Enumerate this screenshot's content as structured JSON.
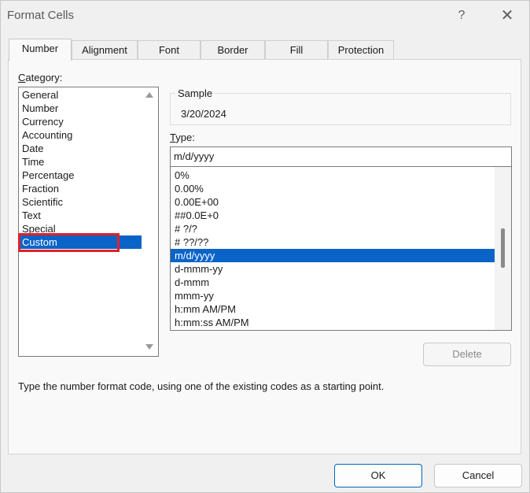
{
  "window": {
    "title": "Format Cells",
    "help_glyph": "?",
    "close_glyph": "✕"
  },
  "tabs": [
    {
      "label": "Number",
      "active": true
    },
    {
      "label": "Alignment",
      "active": false
    },
    {
      "label": "Font",
      "active": false
    },
    {
      "label": "Border",
      "active": false
    },
    {
      "label": "Fill",
      "active": false
    },
    {
      "label": "Protection",
      "active": false
    }
  ],
  "category": {
    "label_accel": "C",
    "label_rest": "ategory:",
    "items": [
      "General",
      "Number",
      "Currency",
      "Accounting",
      "Date",
      "Time",
      "Percentage",
      "Fraction",
      "Scientific",
      "Text",
      "Special",
      "Custom"
    ],
    "selected": "Custom"
  },
  "sample": {
    "label": "Sample",
    "value": "3/20/2024"
  },
  "type": {
    "label_accel": "T",
    "label_rest": "ype:",
    "value": "m/d/yyyy",
    "items": [
      "0%",
      "0.00%",
      "0.00E+00",
      "##0.0E+0",
      "# ?/?",
      "# ??/??",
      "m/d/yyyy",
      "d-mmm-yy",
      "d-mmm",
      "mmm-yy",
      "h:mm AM/PM",
      "h:mm:ss AM/PM"
    ],
    "selected": "m/d/yyyy"
  },
  "buttons": {
    "delete": "Delete",
    "ok": "OK",
    "cancel": "Cancel"
  },
  "hint": "Type the number format code, using one of the existing codes as a starting point.",
  "colors": {
    "selection": "#0a64c8",
    "highlight_box": "#e0202a",
    "ok_border": "#0067c0"
  }
}
